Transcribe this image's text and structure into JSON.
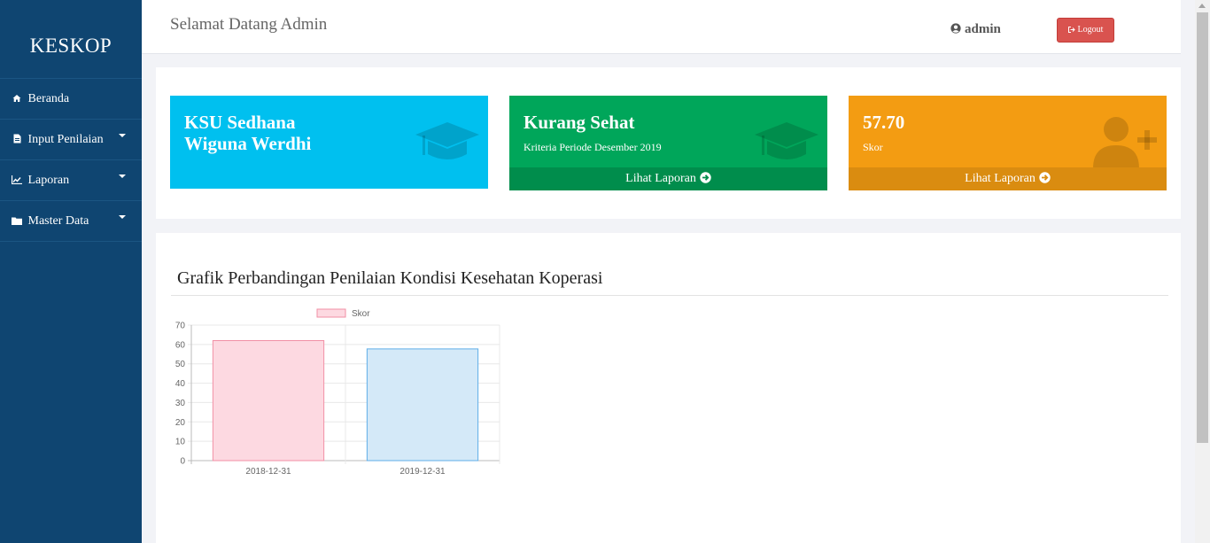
{
  "sidebar": {
    "brand": "KESKOP",
    "items": [
      {
        "label": "Beranda",
        "icon": "home-icon",
        "has_caret": false
      },
      {
        "label": "Input Penilaian",
        "icon": "file-icon",
        "has_caret": true
      },
      {
        "label": "Laporan",
        "icon": "line-chart-icon",
        "has_caret": true
      },
      {
        "label": "Master Data",
        "icon": "folder-icon",
        "has_caret": true
      }
    ]
  },
  "header": {
    "welcome": "Selamat Datang Admin",
    "user": "admin",
    "logout": "Logout"
  },
  "boxes": [
    {
      "title_line1": "KSU Sedhana",
      "title_line2": "Wiguna Werdhi",
      "color": "#00c0ef",
      "icon": "graduation-cap-icon"
    },
    {
      "title": "Kurang Sehat",
      "subtitle": "Kriteria Periode Desember 2019",
      "footer": "Lihat Laporan",
      "color": "#00a65a",
      "footer_color": "#008d4c",
      "icon": "graduation-cap-icon"
    },
    {
      "title": "57.70",
      "subtitle": "Skor",
      "footer": "Lihat Laporan",
      "color": "#f39c12",
      "footer_color": "#da8c10",
      "icon": "user-plus-icon"
    }
  ],
  "chart_section": {
    "title": "Grafik Perbandingan Penilaian Kondisi Kesehatan Koperasi"
  },
  "chart_data": {
    "type": "bar",
    "categories": [
      "2018-12-31",
      "2019-12-31"
    ],
    "series": [
      {
        "name": "Skor",
        "values": [
          62,
          57.7
        ]
      }
    ],
    "bar_colors": [
      "#fdd9e1",
      "#d4e9f8"
    ],
    "bar_border_colors": [
      "#f18fa5",
      "#5faee8"
    ],
    "ylim": [
      0,
      70
    ],
    "yticks": [
      0,
      10,
      20,
      30,
      40,
      50,
      60,
      70
    ],
    "grid": true,
    "legend": "top-center"
  }
}
